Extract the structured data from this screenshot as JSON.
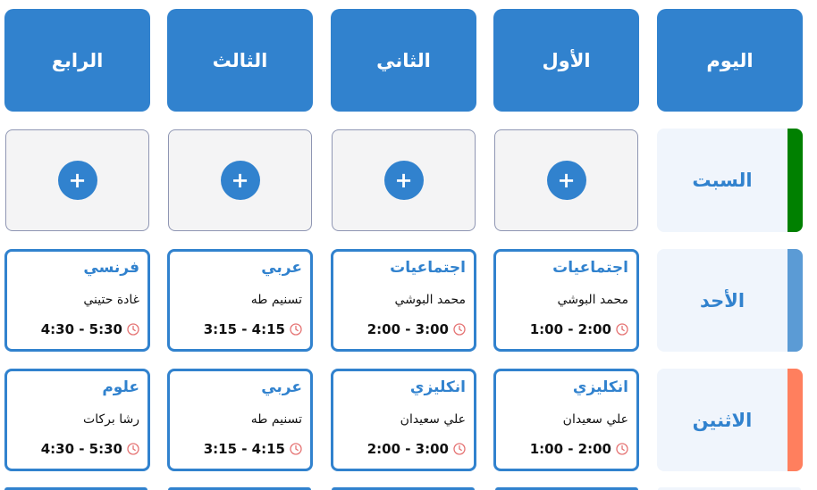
{
  "headers": [
    "اليوم",
    "الأول",
    "الثاني",
    "الثالث",
    "الرابع"
  ],
  "days": [
    {
      "label": "السبت",
      "color": "#008000"
    },
    {
      "label": "الأحد",
      "color": "#5b9bd5"
    },
    {
      "label": "الاثنين",
      "color": "#ff7f5e"
    }
  ],
  "add_icon": "+",
  "rows": [
    {
      "empty": true
    },
    {
      "lessons": [
        {
          "subject": "اجتماعيات",
          "teacher": "محمد البوشي",
          "time": "1:00 - 2:00"
        },
        {
          "subject": "اجتماعيات",
          "teacher": "محمد البوشي",
          "time": "2:00 - 3:00"
        },
        {
          "subject": "عربي",
          "teacher": "تسنيم طه",
          "time": "3:15 - 4:15"
        },
        {
          "subject": "فرنسي",
          "teacher": "غادة حتيني",
          "time": "4:30 - 5:30"
        }
      ]
    },
    {
      "lessons": [
        {
          "subject": "انكليزي",
          "teacher": "علي سعيدان",
          "time": "1:00 - 2:00"
        },
        {
          "subject": "انكليزي",
          "teacher": "علي سعيدان",
          "time": "2:00 - 3:00"
        },
        {
          "subject": "عربي",
          "teacher": "تسنيم طه",
          "time": "3:15 - 4:15"
        },
        {
          "subject": "علوم",
          "teacher": "رشا بركات",
          "time": "4:30 - 5:30"
        }
      ]
    }
  ],
  "colors": {
    "accent": "#3182ce",
    "clock": "#e57373"
  }
}
